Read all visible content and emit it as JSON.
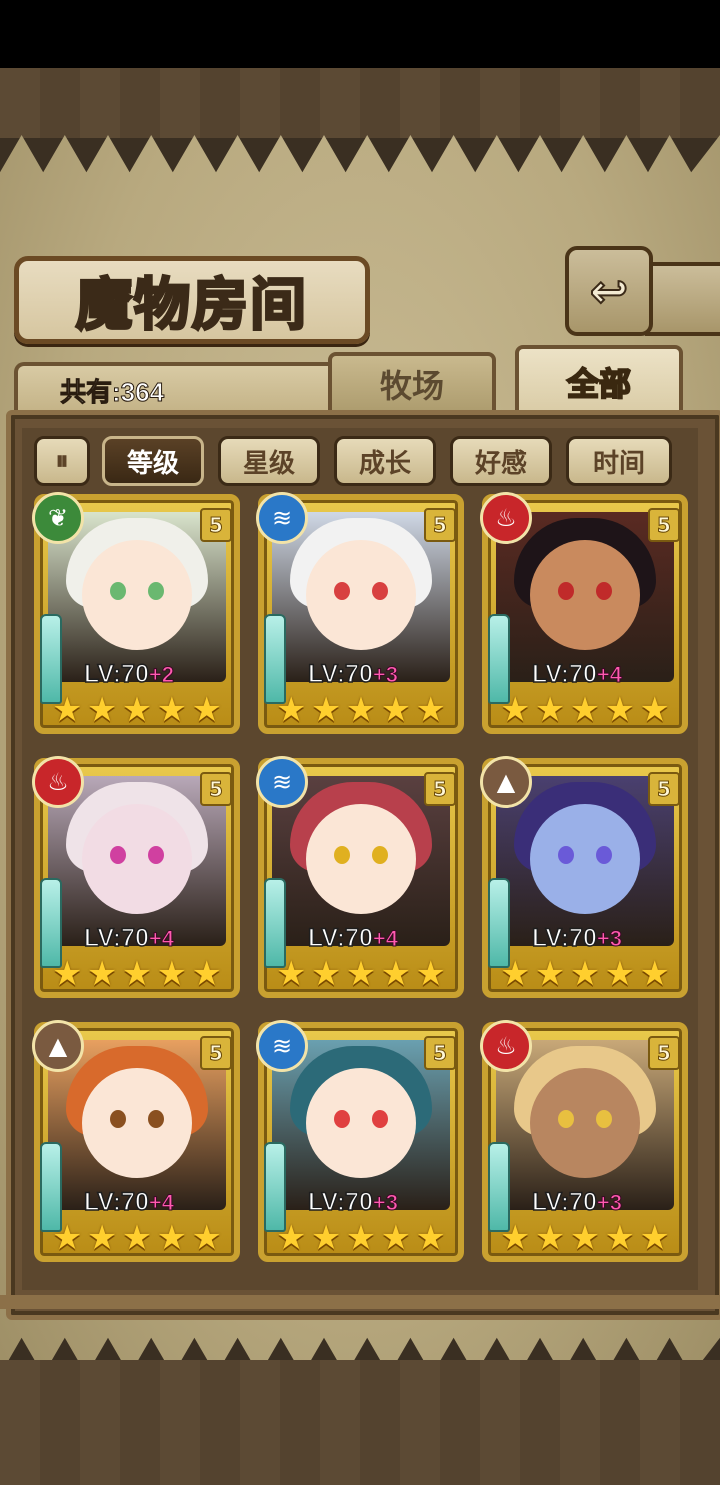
{
  "header": {
    "title": "魔物房间",
    "back_icon": "↩"
  },
  "summary": {
    "count_label": "共有:364"
  },
  "tabs": [
    {
      "label": "牧场",
      "active": false
    },
    {
      "label": "全部",
      "active": true
    }
  ],
  "filters": {
    "sort_toggle_icon": "⏸",
    "options": [
      {
        "label": "等级",
        "active": true
      },
      {
        "label": "星级",
        "active": false
      },
      {
        "label": "成长",
        "active": false
      },
      {
        "label": "好感",
        "active": false
      },
      {
        "label": "时间",
        "active": false
      }
    ]
  },
  "monsters": [
    {
      "element": "wood",
      "element_color": "#3c8a3a",
      "element_glyph": "❦",
      "rarity": "5",
      "level": "LV:70",
      "plus": "+2",
      "stars": 5,
      "hair": "#f0f0ea",
      "skin": "#fbe6d6",
      "eye": "#6ab870",
      "bg": "#d9e4cc"
    },
    {
      "element": "water",
      "element_color": "#2a78c8",
      "element_glyph": "≋",
      "rarity": "5",
      "level": "LV:70",
      "plus": "+3",
      "stars": 5,
      "hair": "#f2f2f2",
      "skin": "#fbe6d6",
      "eye": "#d84040",
      "bg": "#cfd8e6"
    },
    {
      "element": "fire",
      "element_color": "#c8262a",
      "element_glyph": "♨",
      "rarity": "5",
      "level": "LV:70",
      "plus": "+4",
      "stars": 5,
      "hair": "#1e1418",
      "skin": "#c98a5e",
      "eye": "#c02a2a",
      "bg": "#5a2a22"
    },
    {
      "element": "fire",
      "element_color": "#c8262a",
      "element_glyph": "♨",
      "rarity": "5",
      "level": "LV:70",
      "plus": "+4",
      "stars": 5,
      "hair": "#efe3e8",
      "skin": "#f2dce4",
      "eye": "#d040a0",
      "bg": "#b8a8b8"
    },
    {
      "element": "water",
      "element_color": "#2a78c8",
      "element_glyph": "≋",
      "rarity": "5",
      "level": "LV:70",
      "plus": "+4",
      "stars": 5,
      "hair": "#b8404c",
      "skin": "#fbe6d6",
      "eye": "#e0b020",
      "bg": "#5a4040"
    },
    {
      "element": "earth",
      "element_color": "#7a5a40",
      "element_glyph": "▲",
      "rarity": "5",
      "level": "LV:70",
      "plus": "+3",
      "stars": 5,
      "hair": "#3a2e78",
      "skin": "#9ab0e8",
      "eye": "#6a5ad8",
      "bg": "#4a4070"
    },
    {
      "element": "earth",
      "element_color": "#7a5a40",
      "element_glyph": "▲",
      "rarity": "5",
      "level": "LV:70",
      "plus": "+4",
      "stars": 5,
      "hair": "#d86a2c",
      "skin": "#fbe6d6",
      "eye": "#8a5020",
      "bg": "#e8a060"
    },
    {
      "element": "water",
      "element_color": "#2a78c8",
      "element_glyph": "≋",
      "rarity": "5",
      "level": "LV:70",
      "plus": "+3",
      "stars": 5,
      "hair": "#2c6a78",
      "skin": "#fbe6d6",
      "eye": "#e04040",
      "bg": "#6aa0b0"
    },
    {
      "element": "fire",
      "element_color": "#c8262a",
      "element_glyph": "♨",
      "rarity": "5",
      "level": "LV:70",
      "plus": "+3",
      "stars": 5,
      "hair": "#e8c88a",
      "skin": "#b88660",
      "eye": "#e8c040",
      "bg": "#c8a878"
    }
  ]
}
